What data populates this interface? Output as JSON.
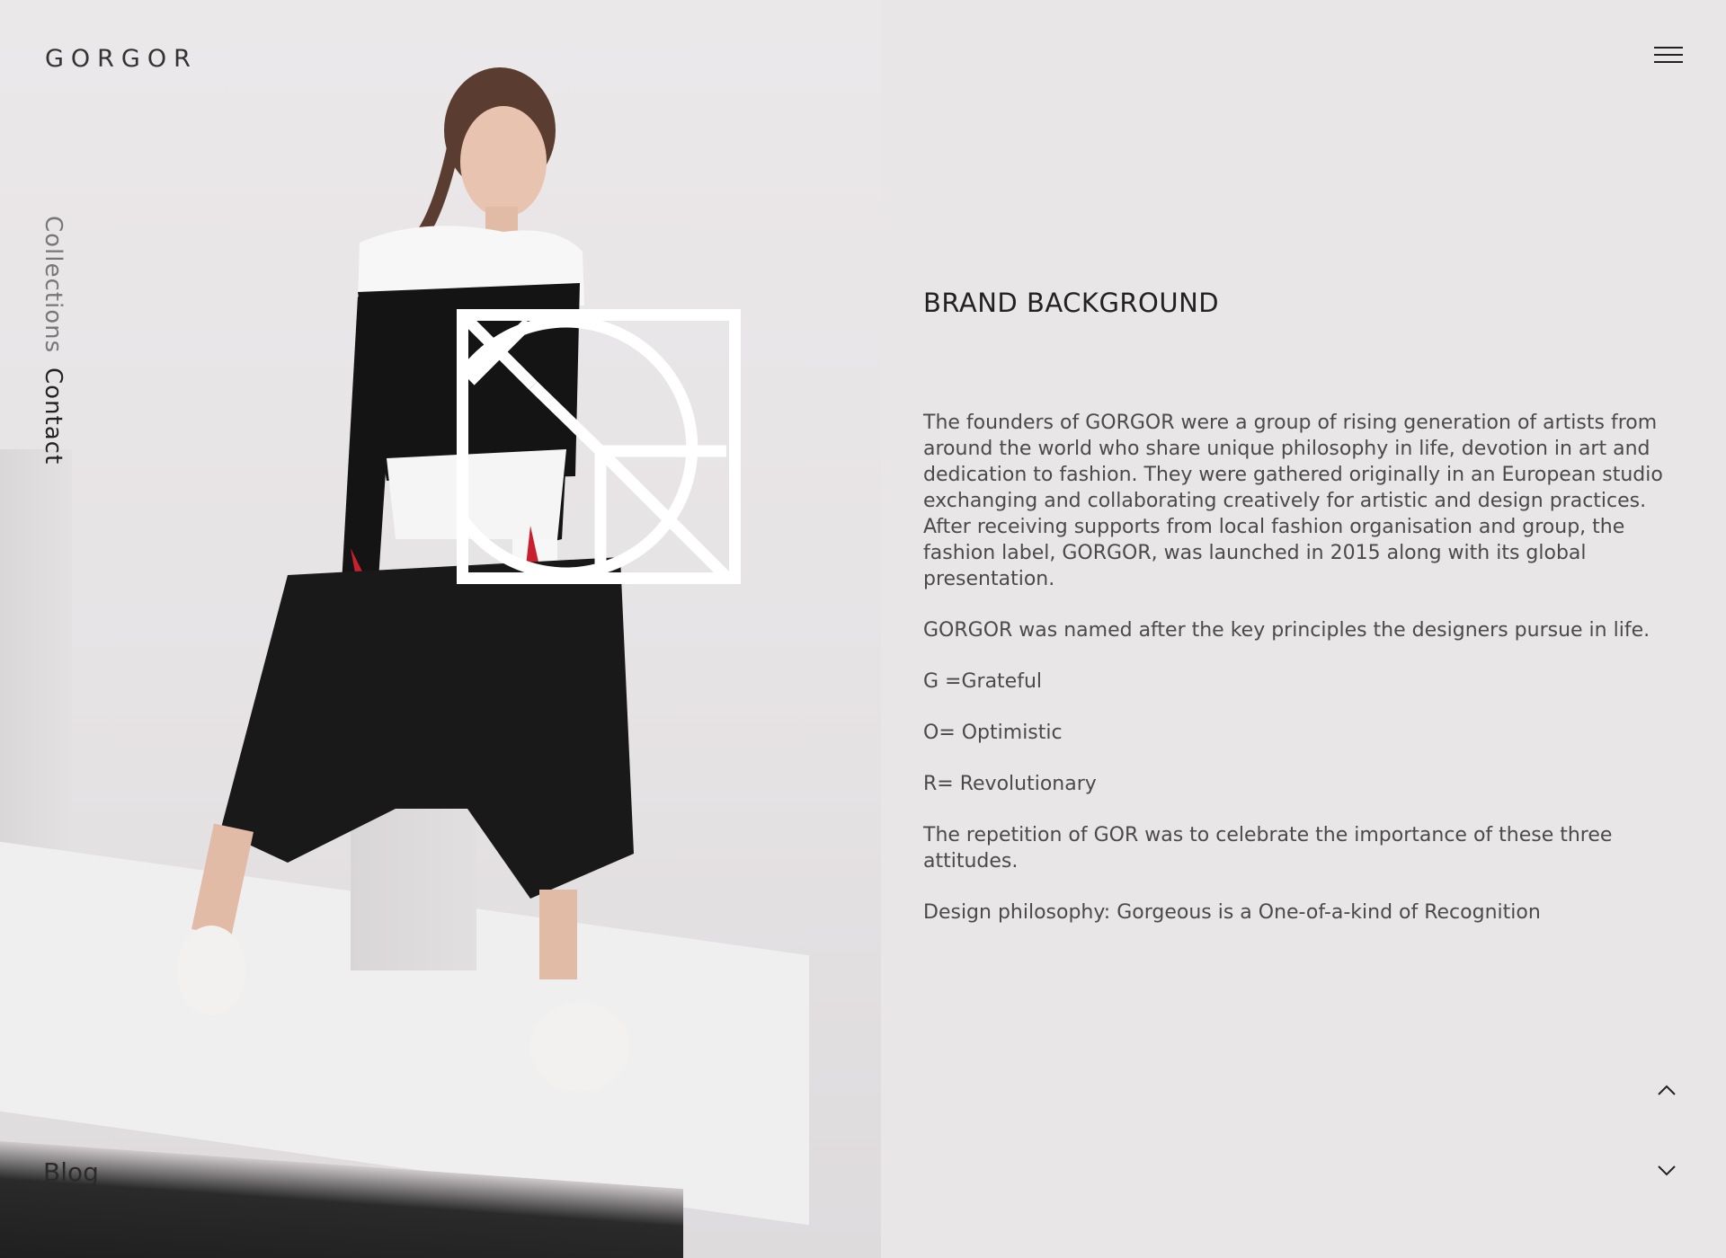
{
  "brand": {
    "logo": "GORGOR"
  },
  "header": {
    "menu_icon": "hamburger-icon"
  },
  "side_nav": {
    "items": [
      {
        "label": "Collections",
        "active": false
      },
      {
        "label": "Contact",
        "active": true
      }
    ]
  },
  "footer_nav": {
    "blog_label": "Blog"
  },
  "main": {
    "title": "BRAND BACKGROUND",
    "paragraphs": [
      "The founders of GORGOR were a group of rising generation of artists from around the world who share unique philosophy in life, devotion in art and dedication to fashion. They were gathered originally in an European studio exchanging and collaborating creatively for artistic and design practices. After receiving supports from local fashion organisation and group, the fashion label, GORGOR, was launched in 2015 along with its global presentation.",
      "GORGOR was named after the key principles the designers pursue in life.",
      "G =Grateful",
      "O= Optimistic",
      "R= Revolutionary",
      "The repetition of GOR was to celebrate the importance of these three attitudes.",
      "Design philosophy: Gorgeous is a One-of-a-kind of Recognition"
    ]
  },
  "controls": {
    "up_icon": "chevron-up-icon",
    "down_icon": "chevron-down-icon"
  },
  "colors": {
    "background": "#e9e6e8",
    "text": "#4a4a4a",
    "accent_red": "#c8202e"
  }
}
